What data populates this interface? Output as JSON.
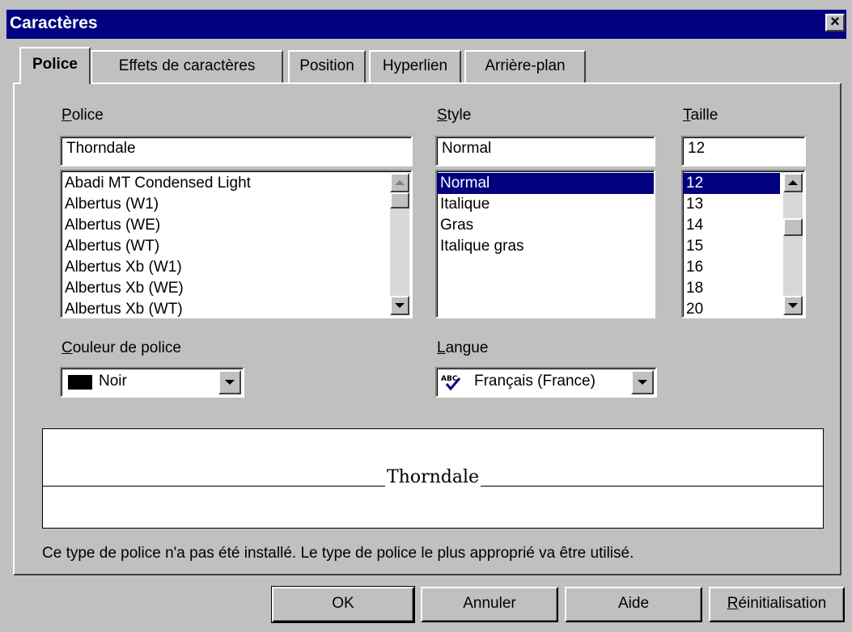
{
  "window": {
    "title": "Caractères",
    "close_glyph": "×"
  },
  "tabs": [
    {
      "label": "Police",
      "active": true
    },
    {
      "label": "Effets de caractères",
      "active": false
    },
    {
      "label": "Position",
      "active": false
    },
    {
      "label": "Hyperlien",
      "active": false
    },
    {
      "label": "Arrière-plan",
      "active": false
    }
  ],
  "font": {
    "label_first": "P",
    "label_rest": "olice",
    "value": "Thorndale",
    "items": [
      "Abadi MT Condensed Light",
      "Albertus (W1)",
      "Albertus (WE)",
      "Albertus (WT)",
      "Albertus Xb (W1)",
      "Albertus Xb (WE)",
      "Albertus Xb (WT)"
    ]
  },
  "style": {
    "label_first": "S",
    "label_rest": "tyle",
    "value": "Normal",
    "items": [
      "Normal",
      "Italique",
      "Gras",
      "Italique gras"
    ],
    "selected": "Normal"
  },
  "size": {
    "label_first": "T",
    "label_rest": "aille",
    "value": "12",
    "items": [
      "12",
      "13",
      "14",
      "15",
      "16",
      "18",
      "20"
    ],
    "selected": "12"
  },
  "color": {
    "label_first": "C",
    "label_rest": "ouleur de police",
    "value": "Noir",
    "swatch": "#000000"
  },
  "language": {
    "label_first": "L",
    "label_rest": "angue",
    "value": "Français (France)",
    "icon": "spellcheck-icon"
  },
  "preview": {
    "text": "Thorndale"
  },
  "notice": "Ce type de police n'a pas été installé. Le type de police le plus approprié va être utilisé.",
  "buttons": {
    "ok": "OK",
    "cancel": "Annuler",
    "help": "Aide",
    "reset_first": "R",
    "reset_rest": "éinitialisation"
  },
  "colors": {
    "titlebar": "#000080",
    "selection": "#000080",
    "face": "#c0c0c0"
  }
}
